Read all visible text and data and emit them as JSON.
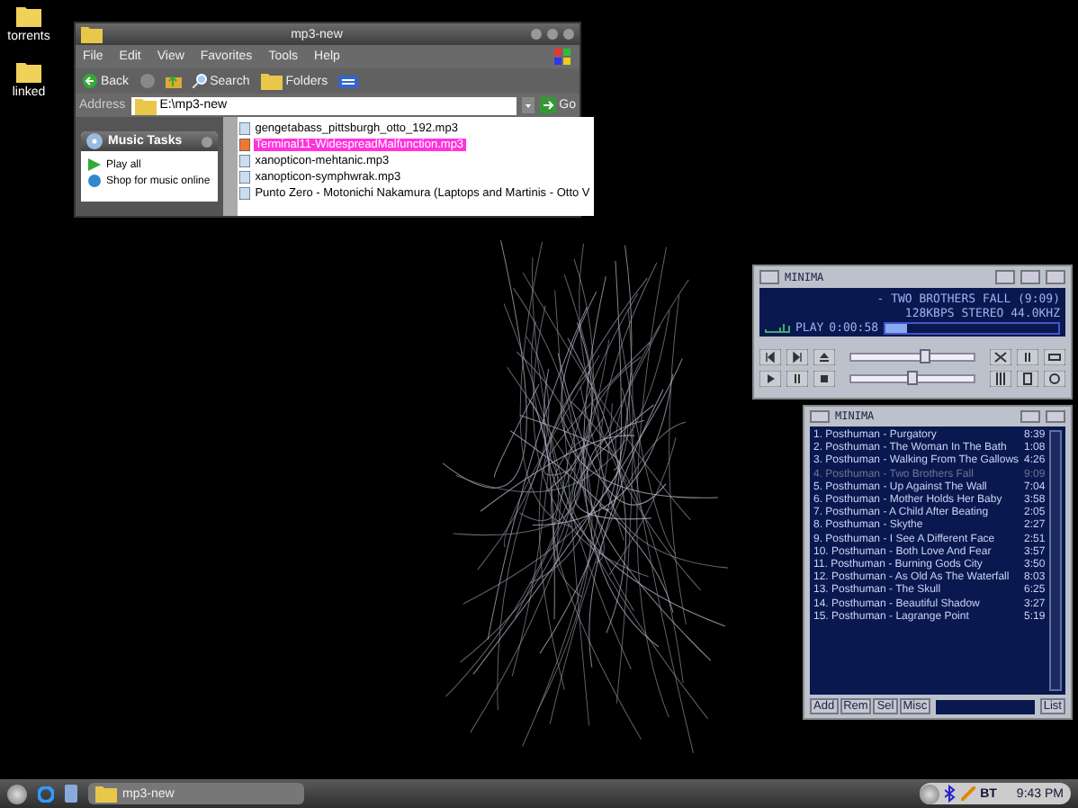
{
  "desktop_icons": [
    {
      "label": "torrents"
    },
    {
      "label": "linked"
    }
  ],
  "explorer": {
    "title": "mp3-new",
    "menu": [
      "File",
      "Edit",
      "View",
      "Favorites",
      "Tools",
      "Help"
    ],
    "toolbar": {
      "back": "Back",
      "search": "Search",
      "folders": "Folders"
    },
    "address": {
      "label": "Address",
      "value": "E:\\mp3-new"
    },
    "go": "Go",
    "task_panel": {
      "title": "Music Tasks",
      "items": [
        "Play all",
        "Shop for music online"
      ]
    },
    "files": [
      {
        "name": "gengetabass_pittsburgh_otto_192.mp3",
        "selected": false
      },
      {
        "name": "Terminal11-WidespreadMalfunction.mp3",
        "selected": true
      },
      {
        "name": "xanopticon-mehtanic.mp3",
        "selected": false
      },
      {
        "name": "xanopticon-symphwrak.mp3",
        "selected": false
      },
      {
        "name": "Punto Zero - Motonichi Nakamura (Laptops and Martinis - Otto V",
        "selected": false
      }
    ]
  },
  "player": {
    "title": "MINIMA",
    "track": "- TWO BROTHERS FALL (9:09)",
    "info": "128KBPS STEREO 44.0KHZ",
    "status": "PLAY",
    "time": "0:00:58",
    "position": {
      "level": 0.12
    },
    "volume": {
      "level": 0.6
    },
    "balance": {
      "level": 0.5
    }
  },
  "playlist": {
    "title": "MINIMA",
    "tracks": [
      {
        "title": "1. Posthuman - Purgatory",
        "duration": "8:39",
        "playing": false
      },
      {
        "title": "2. Posthuman - The Woman In The Bath",
        "duration": "1:08",
        "playing": false
      },
      {
        "title": "3. Posthuman - Walking From The Gallows",
        "duration": "4:26",
        "playing": false
      },
      {
        "title": "4. Posthuman - Two Brothers Fall",
        "duration": "9:09",
        "playing": true
      },
      {
        "title": "5. Posthuman - Up Against The Wall",
        "duration": "7:04",
        "playing": false
      },
      {
        "title": "6. Posthuman - Mother Holds Her Baby",
        "duration": "3:58",
        "playing": false
      },
      {
        "title": "7. Posthuman - A Child After Beating",
        "duration": "2:05",
        "playing": false
      },
      {
        "title": "8. Posthuman - Skythe",
        "duration": "2:27",
        "playing": false
      },
      {
        "title": "9. Posthuman - I See A Different Face",
        "duration": "2:51",
        "playing": false
      },
      {
        "title": "10. Posthuman - Both Love And Fear",
        "duration": "3:57",
        "playing": false
      },
      {
        "title": "11. Posthuman - Burning Gods City",
        "duration": "3:50",
        "playing": false
      },
      {
        "title": "12. Posthuman - As Old As The Waterfall",
        "duration": "8:03",
        "playing": false
      },
      {
        "title": "13. Posthuman - The Skull",
        "duration": "6:25",
        "playing": false
      },
      {
        "title": "14. Posthuman - Beautiful Shadow",
        "duration": "3:27",
        "playing": false
      },
      {
        "title": "15. Posthuman - Lagrange Point",
        "duration": "5:19",
        "playing": false
      }
    ],
    "buttons": [
      "Add",
      "Rem",
      "Sel",
      "Misc"
    ],
    "list_button": "List"
  },
  "taskbar": {
    "task": "mp3-new",
    "tray_label": "BT",
    "clock": "9:43 PM"
  }
}
